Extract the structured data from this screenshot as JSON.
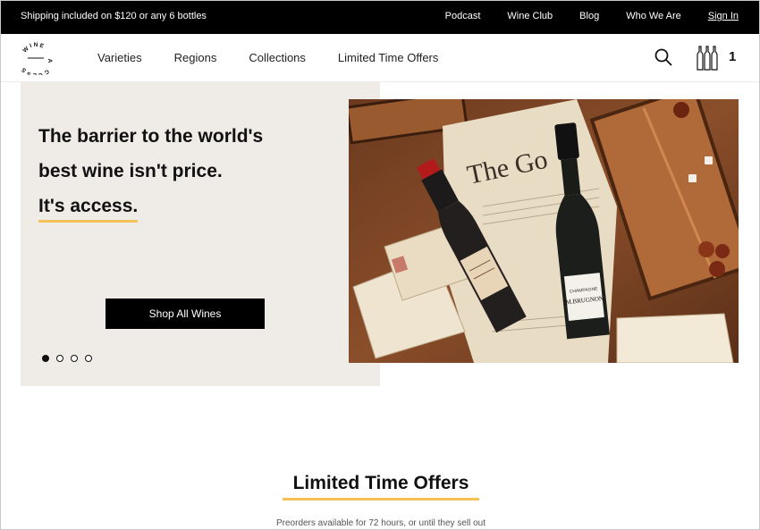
{
  "topbar": {
    "shipping": "Shipping included on $120 or any 6 bottles",
    "links": [
      "Podcast",
      "Wine Club",
      "Blog",
      "Who We Are"
    ],
    "sign_in": "Sign In"
  },
  "nav": {
    "logo_text": "WINE ACCESS",
    "menu": [
      "Varieties",
      "Regions",
      "Collections",
      "Limited Time Offers"
    ],
    "cart_count": "1"
  },
  "hero": {
    "headline_1": "The barrier to the world's",
    "headline_2": "best wine isn't price.",
    "headline_3": "It's access.",
    "cta": "Shop All Wines",
    "slides": 4,
    "active_slide": 1,
    "image_icon": "wine-bottles-photo"
  },
  "section": {
    "title": "Limited Time Offers",
    "subtitle": "Preorders available for 72 hours, or until they sell out"
  },
  "colors": {
    "accent": "#f5c25a",
    "hero_bg": "#efebe7",
    "bar": "#000000"
  }
}
